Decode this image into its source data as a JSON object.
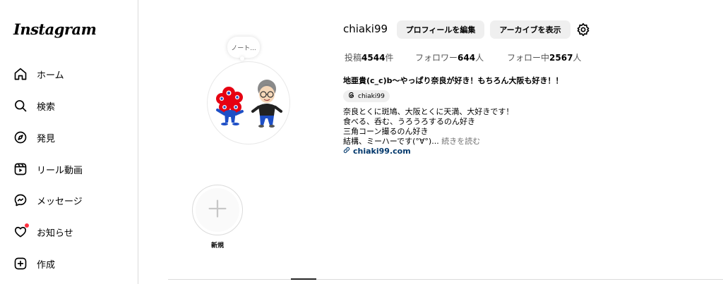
{
  "sidebar": {
    "logo": "Instagram",
    "items": [
      {
        "label": "ホーム",
        "icon": "home-icon"
      },
      {
        "label": "検索",
        "icon": "search-icon"
      },
      {
        "label": "発見",
        "icon": "compass-icon"
      },
      {
        "label": "リール動画",
        "icon": "reels-icon"
      },
      {
        "label": "メッセージ",
        "icon": "messenger-icon"
      },
      {
        "label": "お知らせ",
        "icon": "heart-icon"
      },
      {
        "label": "作成",
        "icon": "plus-square-icon"
      }
    ]
  },
  "profile": {
    "username": "chiaki99",
    "edit_label": "プロフィールを編集",
    "archive_label": "アーカイブを表示",
    "note": "ノート...",
    "stats": {
      "posts_label": "投稿",
      "posts_value": "4544",
      "posts_unit": "件",
      "followers_label": "フォロワー",
      "followers_value": "644",
      "followers_unit": "人",
      "following_label": "フォロー中",
      "following_value": "2567",
      "following_unit": "人"
    },
    "name": "地亜貴(c_c)b〜やっぱり奈良が好き！もちろん大阪も好き！！",
    "threads_handle": "chiaki99",
    "bio_lines": [
      "奈良とくに斑鳩、大阪とくに天満、大好きです！",
      "食べる、呑む、うろうろするのん好き",
      "三角コーン撮るのん好き",
      "結構、ミーハーです(°∀°)..."
    ],
    "more_label": "続きを読む",
    "link": "chiaki99.com",
    "new_highlight_label": "新規"
  },
  "colors": {
    "accent_link": "#00376b",
    "button_bg": "#efefef",
    "notification_dot": "#ff3040"
  }
}
